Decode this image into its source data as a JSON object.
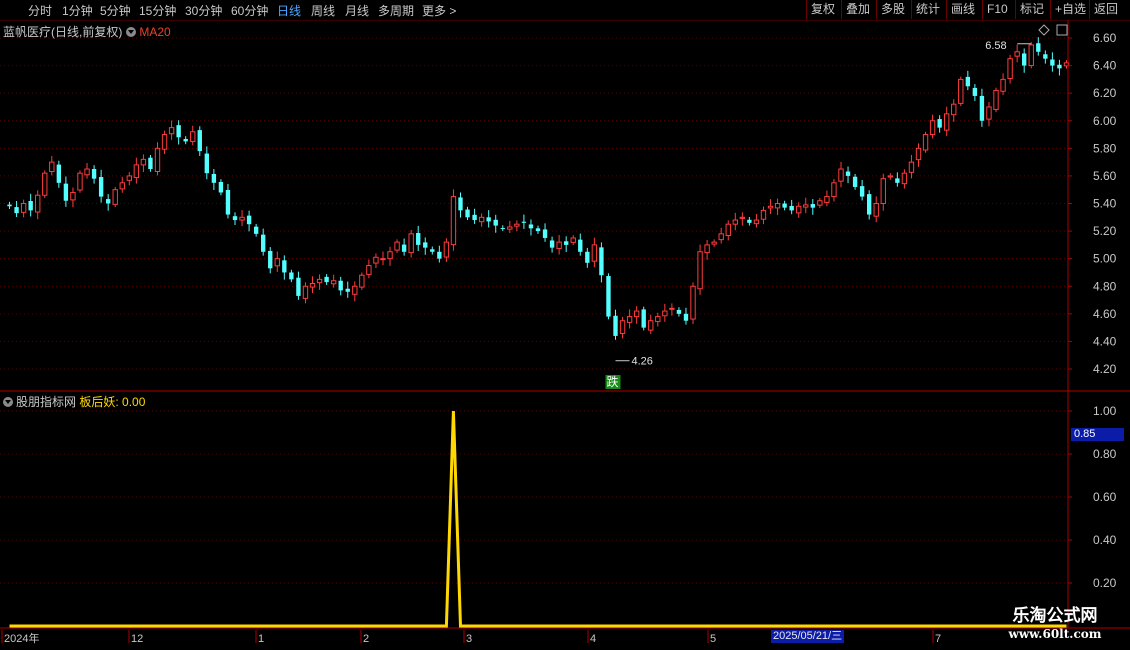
{
  "toolbar": {
    "periods": [
      "分时",
      "1分钟",
      "5分钟",
      "15分钟",
      "30分钟",
      "60分钟",
      "日线",
      "周线",
      "月线",
      "多周期",
      "更多 >"
    ],
    "active_period": "日线",
    "tools": [
      "复权",
      "叠加",
      "多股",
      "统计",
      "画线",
      "F10",
      "标记",
      "+自选",
      "返回"
    ]
  },
  "main_chart": {
    "stock_name": "蓝帆医疗",
    "mode": "(日线,前复权)",
    "ma_label": "MA20",
    "y_ticks": [
      "6.60",
      "6.40",
      "6.20",
      "6.00",
      "5.80",
      "5.60",
      "5.40",
      "5.20",
      "5.00",
      "4.80",
      "4.60",
      "4.40",
      "4.20"
    ],
    "high_label": "6.58",
    "low_label": "4.26",
    "signal_tag": "跌"
  },
  "sub_chart": {
    "indicator_name": "股朋指标网",
    "series_label": "板后妖:",
    "series_value": "0.00",
    "y_ticks": [
      "1.00",
      "0.80",
      "0.60",
      "0.40",
      "0.20"
    ],
    "cursor_value": "0.85"
  },
  "x_axis": {
    "labels": [
      "2024年",
      "12",
      "1",
      "2",
      "3",
      "4",
      "5",
      "7"
    ],
    "cursor_date": "2025/05/21/三"
  },
  "watermark": {
    "line1": "乐淘公式网",
    "line2": "www.60lt.com"
  },
  "colors": {
    "up": "#ff3c3c",
    "down": "#54ffff",
    "indicator": "#ffd800",
    "axis_red": "#b00000",
    "cursor_blue": "#0a1ca8"
  },
  "chart_data": [
    {
      "type": "candlestick",
      "title": "蓝帆医疗(日线,前复权)",
      "ylim": [
        4.15,
        6.68
      ],
      "y_ticks": [
        6.6,
        6.4,
        6.2,
        6.0,
        5.8,
        5.6,
        5.4,
        5.2,
        5.0,
        4.8,
        4.6,
        4.4,
        4.2
      ],
      "closes": [
        5.38,
        5.33,
        5.4,
        5.35,
        5.46,
        5.62,
        5.7,
        5.55,
        5.42,
        5.48,
        5.62,
        5.65,
        5.58,
        5.45,
        5.4,
        5.5,
        5.55,
        5.6,
        5.68,
        5.72,
        5.65,
        5.8,
        5.9,
        5.95,
        5.88,
        5.85,
        5.92,
        5.78,
        5.62,
        5.55,
        5.48,
        5.32,
        5.28,
        5.3,
        5.25,
        5.18,
        5.05,
        4.93,
        5.0,
        4.9,
        4.85,
        4.73,
        4.8,
        4.82,
        4.85,
        4.83,
        4.84,
        4.77,
        4.76,
        4.8,
        4.88,
        4.95,
        5.01,
        5.0,
        5.05,
        5.12,
        5.05,
        5.18,
        5.1,
        5.08,
        5.05,
        5.0,
        5.12,
        5.45,
        5.35,
        5.3,
        5.28,
        5.3,
        5.27,
        5.24,
        5.22,
        5.23,
        5.25,
        5.26,
        5.22,
        5.2,
        5.15,
        5.08,
        5.12,
        5.1,
        5.15,
        5.05,
        4.97,
        5.1,
        4.88,
        4.58,
        4.44,
        4.55,
        4.58,
        4.62,
        4.5,
        4.55,
        4.58,
        4.62,
        4.64,
        4.6,
        4.55,
        4.8,
        5.05,
        5.1,
        5.12,
        5.18,
        5.25,
        5.28,
        5.3,
        5.26,
        5.28,
        5.35,
        5.38,
        5.4,
        5.37,
        5.35,
        5.38,
        5.39,
        5.37,
        5.42,
        5.45,
        5.55,
        5.65,
        5.6,
        5.52,
        5.45,
        5.32,
        5.4,
        5.58,
        5.6,
        5.55,
        5.62,
        5.7,
        5.8,
        5.9,
        6.0,
        5.95,
        6.05,
        6.12,
        6.3,
        6.25,
        6.18,
        6.0,
        6.1,
        6.22,
        6.3,
        6.45,
        6.5,
        6.4,
        6.55,
        6.5,
        6.45,
        6.4,
        6.38,
        6.42
      ],
      "high": 6.58,
      "low": 4.26
    },
    {
      "type": "line",
      "title": "板后妖",
      "ylim": [
        0,
        1.0
      ],
      "y_ticks": [
        1.0,
        0.8,
        0.6,
        0.4,
        0.2
      ],
      "spike_index": 63,
      "spike_value": 1.0,
      "base_value": 0.0
    }
  ]
}
